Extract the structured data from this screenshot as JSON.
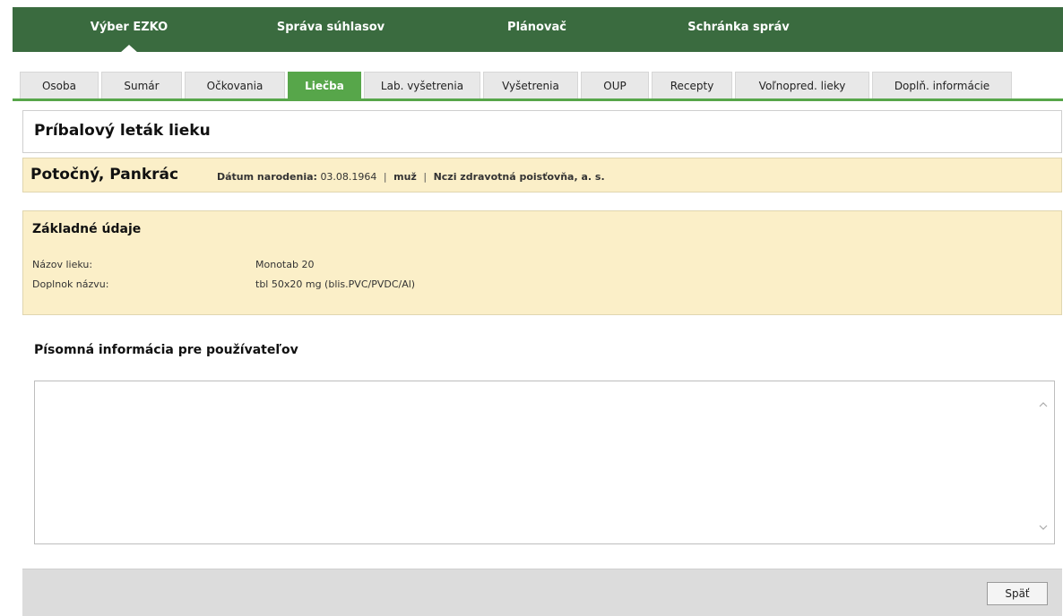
{
  "top_nav": [
    {
      "label": "Výber EZKO",
      "active": true
    },
    {
      "label": "Správa súhlasov",
      "active": false
    },
    {
      "label": "Plánovač",
      "active": false
    },
    {
      "label": "Schránka správ",
      "active": false
    }
  ],
  "tabs": [
    {
      "label": "Osoba",
      "active": false
    },
    {
      "label": "Sumár",
      "active": false
    },
    {
      "label": "Očkovania",
      "active": false
    },
    {
      "label": "Liečba",
      "active": true
    },
    {
      "label": "Lab. vyšetrenia",
      "active": false
    },
    {
      "label": "Vyšetrenia",
      "active": false
    },
    {
      "label": "OUP",
      "active": false
    },
    {
      "label": "Recepty",
      "active": false
    },
    {
      "label": "Voľnopred. lieky",
      "active": false
    },
    {
      "label": "Doplň. informácie",
      "active": false
    }
  ],
  "page_title": "Príbalový leták lieku",
  "patient": {
    "name": "Potočný, Pankrác",
    "dob_label": "Dátum narodenia:",
    "dob_value": "03.08.1964",
    "sex": "muž",
    "insurer": "Nczi zdravotná poisťovňa, a. s."
  },
  "basic_data": {
    "title": "Základné údaje",
    "rows": [
      {
        "label": "Názov lieku:",
        "value": "Monotab 20"
      },
      {
        "label": "Doplnok názvu:",
        "value": "tbl 50x20 mg (blis.PVC/PVDC/Al)"
      }
    ]
  },
  "written_info": {
    "title": "Písomná informácia pre používateľov",
    "content": ""
  },
  "footer": {
    "back_label": "Späť"
  },
  "colors": {
    "topbar": "#3a6b3f",
    "accent": "#57a64a",
    "highlight_bg": "#fbefc8"
  },
  "icons": [
    "chevron-up-icon",
    "chevron-down-icon"
  ]
}
